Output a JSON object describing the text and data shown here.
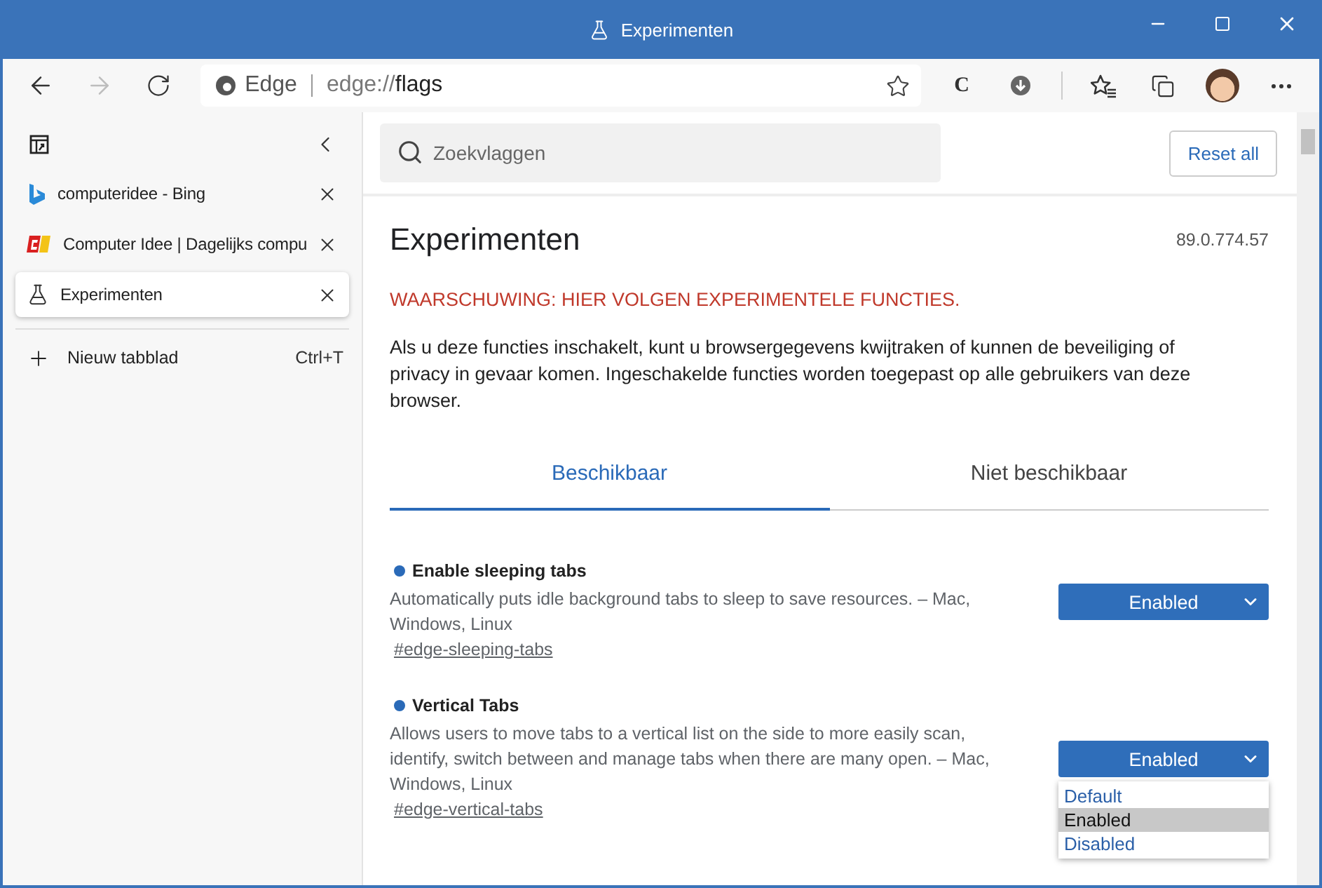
{
  "window": {
    "title": "Experimenten"
  },
  "toolbar": {
    "address": {
      "brand": "Edge",
      "scheme": "edge://",
      "path": "flags"
    },
    "extension_letter": "C"
  },
  "sidebar": {
    "tabs": [
      {
        "title": "computeridee - Bing",
        "selected": false
      },
      {
        "title": "Computer Idee | Dagelijks compu",
        "selected": false
      },
      {
        "title": "Experimenten",
        "selected": true
      }
    ],
    "new_tab": {
      "label": "Nieuw tabblad",
      "shortcut": "Ctrl+T"
    }
  },
  "search": {
    "placeholder": "Zoekvlaggen"
  },
  "reset_button": "Reset all",
  "page": {
    "title": "Experimenten",
    "version": "89.0.774.57",
    "warning": "WAARSCHUWING: HIER VOLGEN EXPERIMENTELE FUNCTIES.",
    "intro": "Als u deze functies inschakelt, kunt u browsergegevens kwijtraken of kunnen de beveiliging of privacy in gevaar komen. Ingeschakelde functies worden toegepast op alle gebruikers van deze browser."
  },
  "tabs": [
    {
      "label": "Beschikbaar",
      "selected": true
    },
    {
      "label": "Niet beschikbaar",
      "selected": false
    }
  ],
  "flags": [
    {
      "name": "Enable sleeping tabs",
      "description": "Automatically puts idle background tabs to sleep to save resources. – Mac, Windows, Linux",
      "link": "#edge-sleeping-tabs",
      "value": "Enabled"
    },
    {
      "name": "Vertical Tabs",
      "description": "Allows users to move tabs to a vertical list on the side to more easily scan, identify, switch between and manage tabs when there are many open. – Mac, Windows, Linux",
      "link": "#edge-vertical-tabs",
      "value": "Enabled",
      "options": [
        {
          "label": "Default",
          "selected": false
        },
        {
          "label": "Enabled",
          "selected": true
        },
        {
          "label": "Disabled",
          "selected": false
        }
      ]
    }
  ]
}
